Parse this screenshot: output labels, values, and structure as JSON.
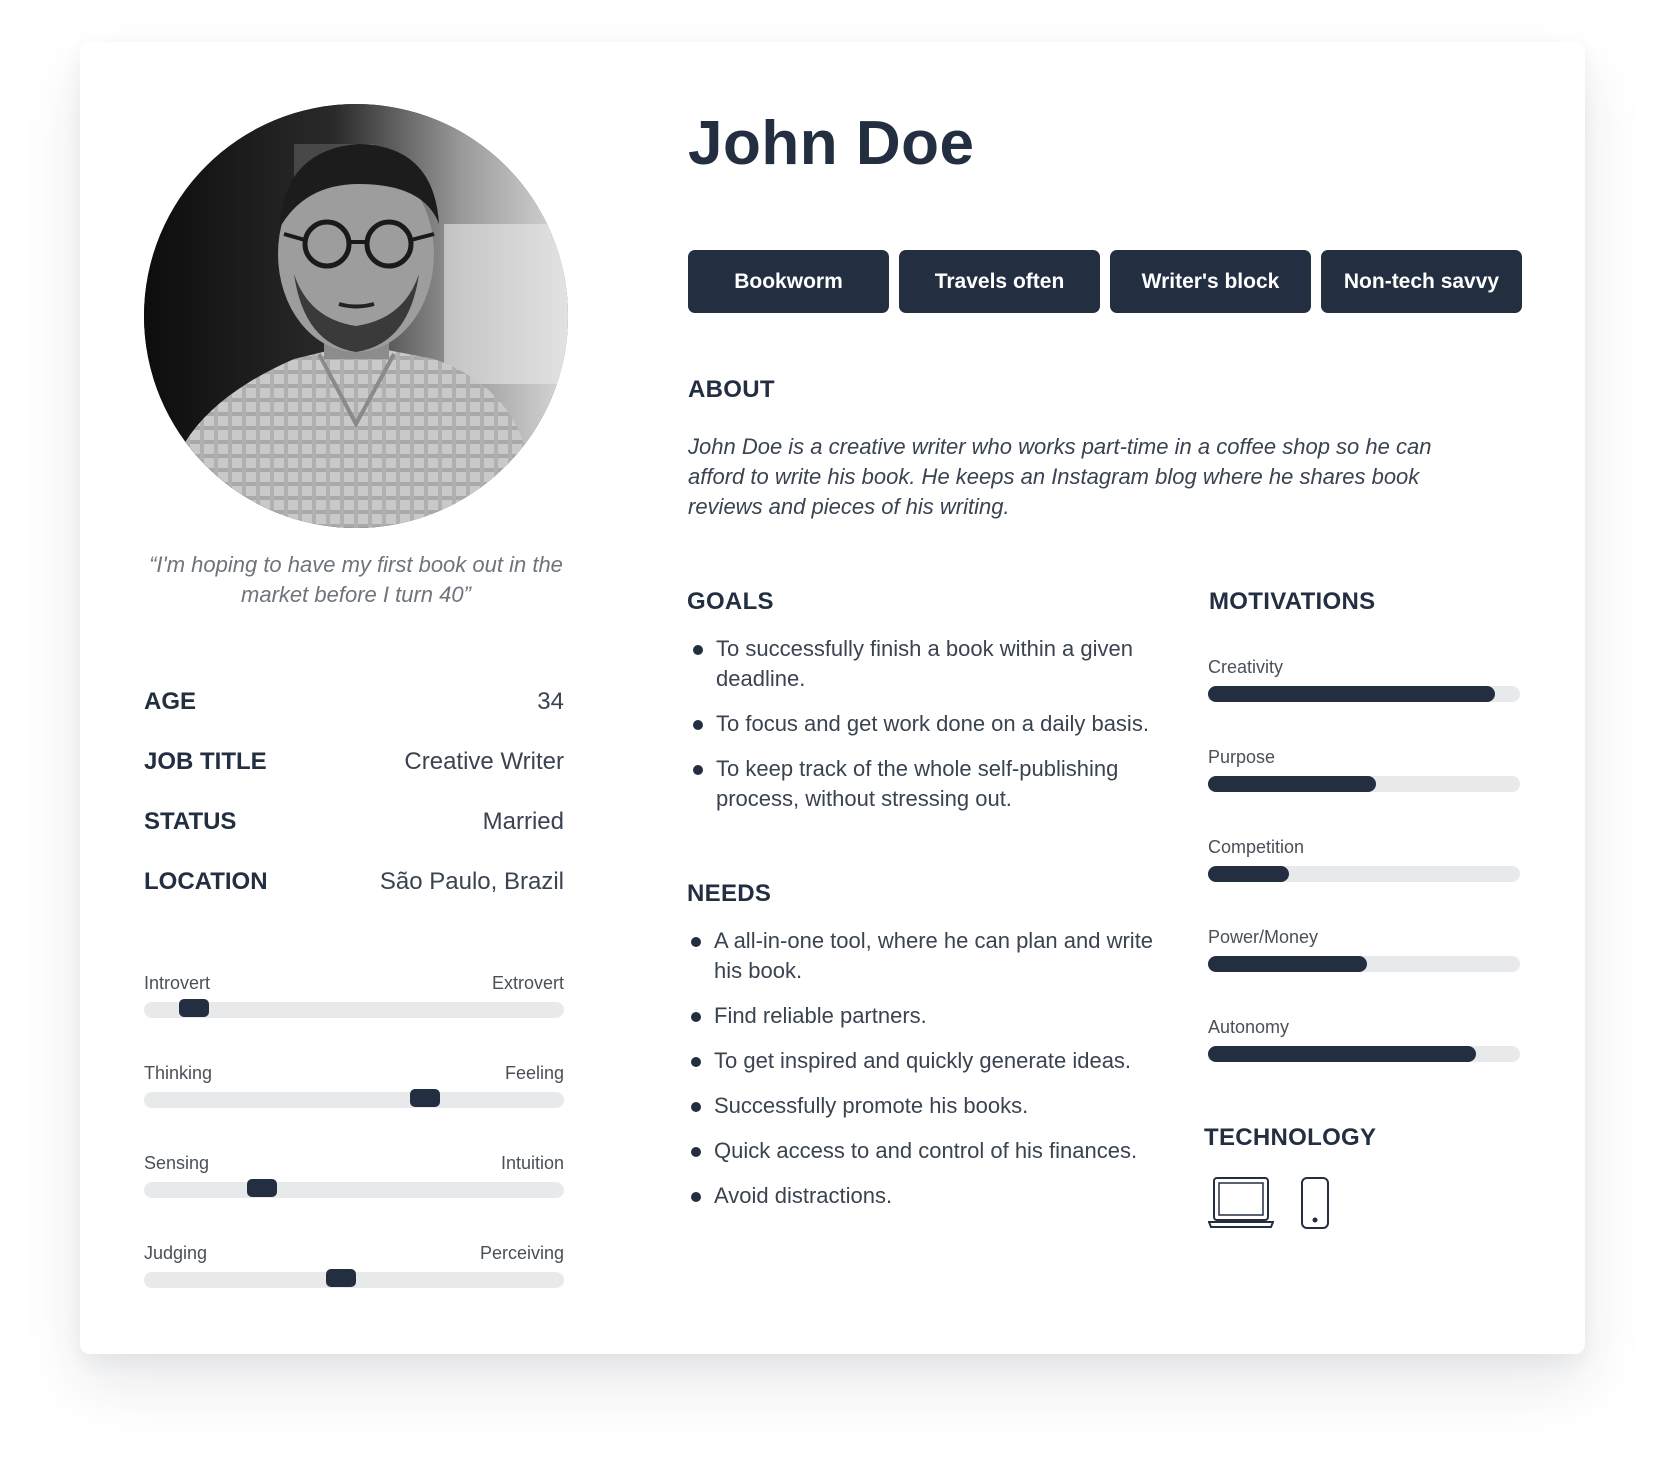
{
  "persona": {
    "name": "John Doe",
    "quote": "“I'm hoping to have my first book out in the market before I turn 40”",
    "tags": [
      "Bookworm",
      "Travels often",
      "Writer's block",
      "Non-tech savvy"
    ],
    "facts": [
      {
        "label": "AGE",
        "value": "34"
      },
      {
        "label": "JOB TITLE",
        "value": "Creative Writer"
      },
      {
        "label": "STATUS",
        "value": "Married"
      },
      {
        "label": "LOCATION",
        "value": "São Paulo, Brazil"
      }
    ],
    "traits": [
      {
        "left": "Introvert",
        "right": "Extrovert",
        "level": 0.12
      },
      {
        "left": "Thinking",
        "right": "Feeling",
        "level": 0.67
      },
      {
        "left": "Sensing",
        "right": "Intuition",
        "level": 0.28
      },
      {
        "left": "Judging",
        "right": "Perceiving",
        "level": 0.47
      }
    ]
  },
  "about": {
    "title": "ABOUT",
    "text": "John Doe is a creative writer who works part-time in a coffee shop so he can afford to write his book. He keeps an Instagram blog where he shares book reviews and pieces of his writing."
  },
  "goals": {
    "title": "GOALS",
    "items": [
      "To successfully finish a book within a given deadline.",
      "To focus and get work done on a daily basis.",
      "To keep track of the whole self-publishing process, without stressing out."
    ]
  },
  "needs": {
    "title": "NEEDS",
    "items": [
      "A all-in-one tool, where he can plan and write his book.",
      "Find reliable partners.",
      "To get inspired and quickly generate ideas.",
      "Successfully promote his books.",
      "Quick access to and control of his finances.",
      "Avoid distractions."
    ]
  },
  "motivations": {
    "title": "MOTIVATIONS",
    "items": [
      {
        "label": "Creativity",
        "level": 0.92
      },
      {
        "label": "Purpose",
        "level": 0.54
      },
      {
        "label": "Competition",
        "level": 0.26
      },
      {
        "label": "Power/Money",
        "level": 0.51
      },
      {
        "label": "Autonomy",
        "level": 0.86
      }
    ]
  },
  "technology": {
    "title": "TECHNOLOGY",
    "icons": [
      "laptop-icon",
      "smartphone-icon"
    ]
  },
  "colors": {
    "primary": "#232f41",
    "track": "#e8e9eb",
    "text_muted": "#6f747c"
  }
}
